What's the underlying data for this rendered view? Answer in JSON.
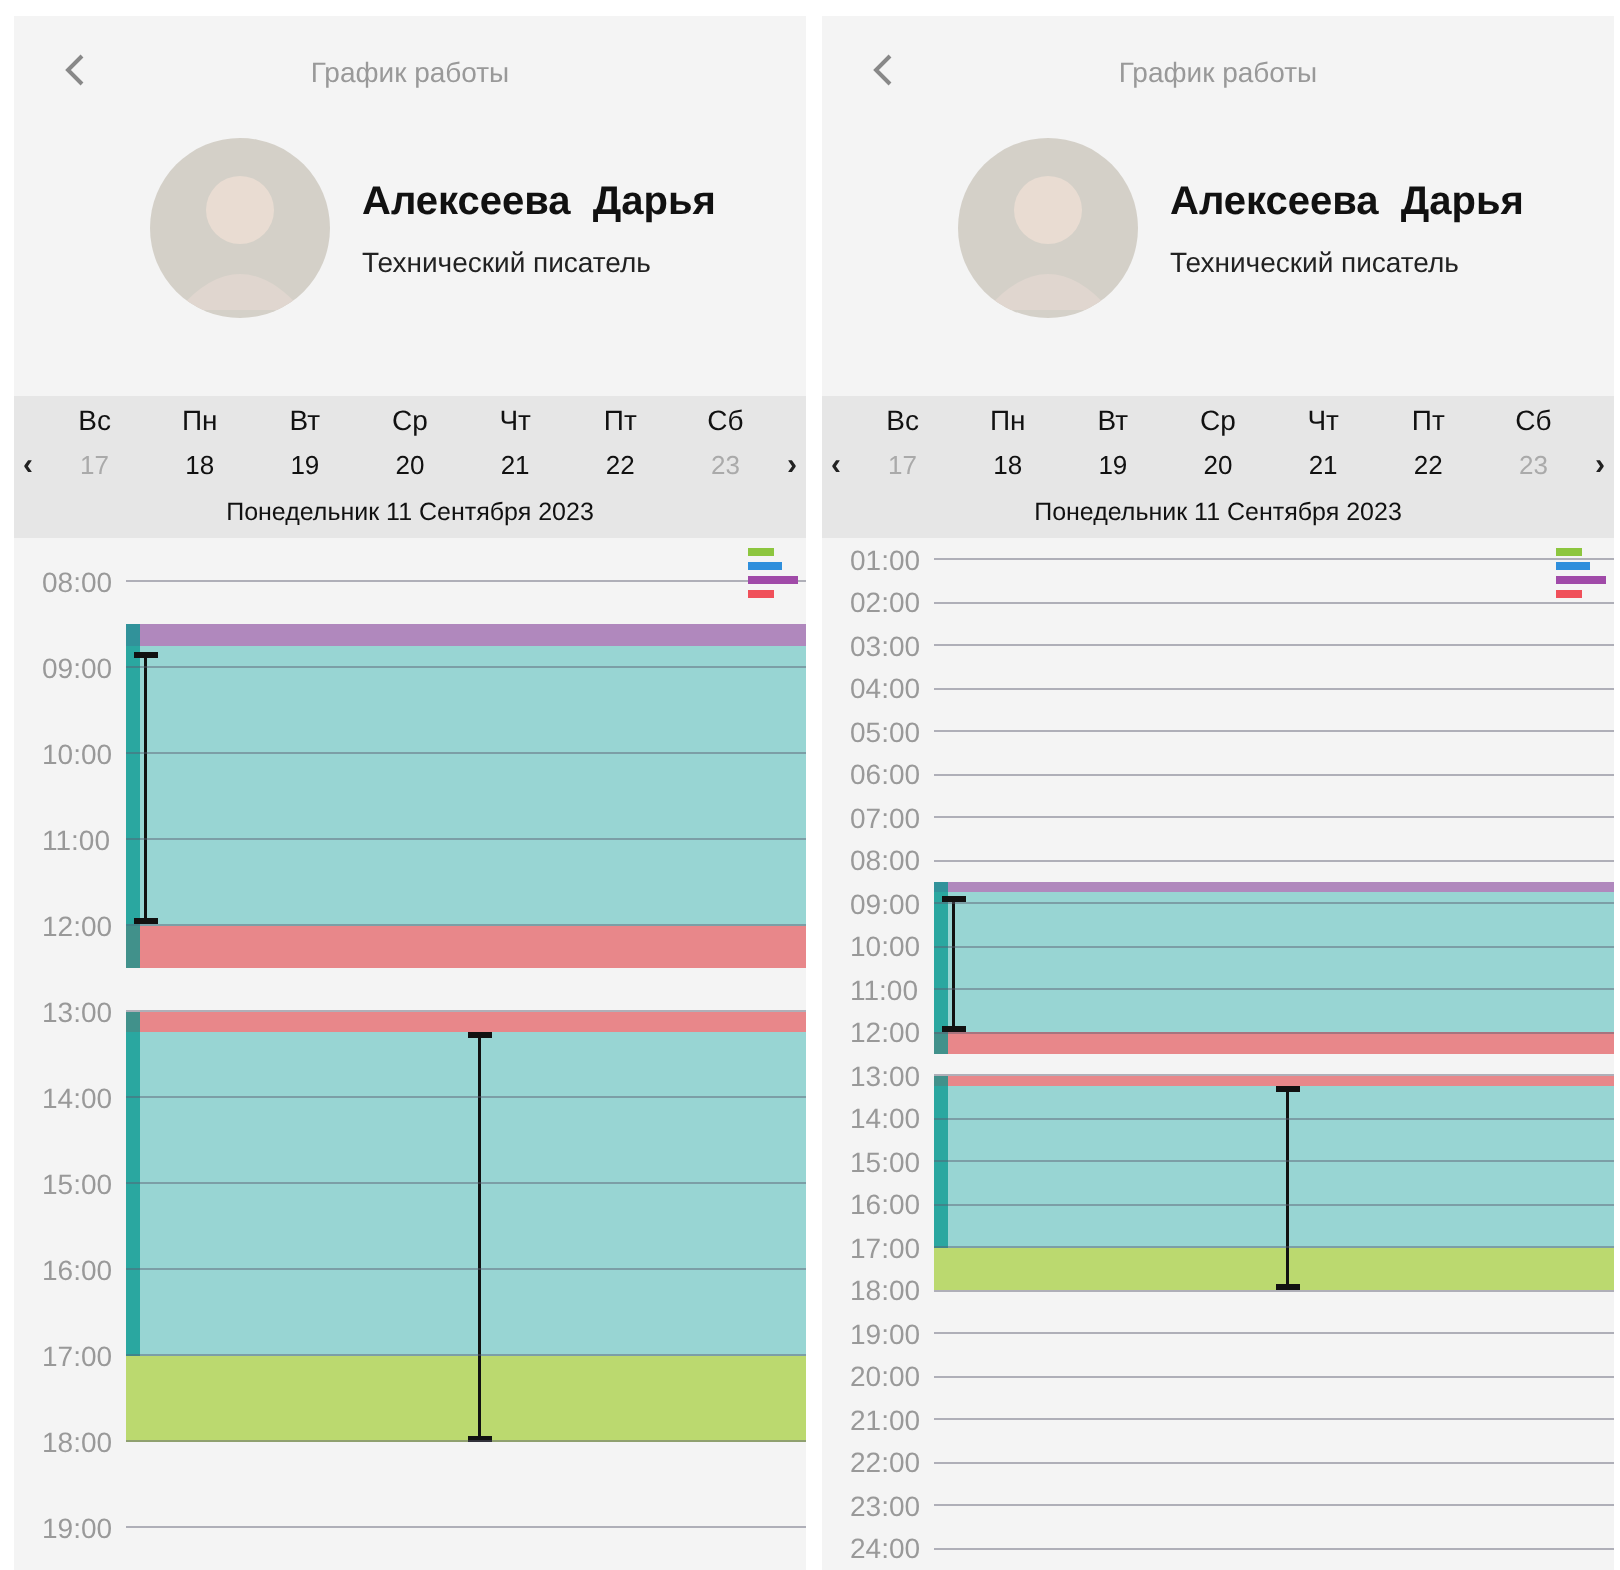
{
  "screens": [
    {
      "title": "График работы",
      "profile": {
        "name": "Алексеева  Дарья",
        "position": "Технический писатель"
      },
      "week": {
        "prev": "‹",
        "next": "›",
        "days": [
          {
            "weekday": "Вс",
            "date": "17",
            "disabled": true
          },
          {
            "weekday": "Пн",
            "date": "18",
            "disabled": false
          },
          {
            "weekday": "Вт",
            "date": "19",
            "disabled": false
          },
          {
            "weekday": "Ср",
            "date": "20",
            "disabled": false
          },
          {
            "weekday": "Чт",
            "date": "21",
            "disabled": false
          },
          {
            "weekday": "Пт",
            "date": "22",
            "disabled": false
          },
          {
            "weekday": "Сб",
            "date": "23",
            "disabled": true
          }
        ]
      },
      "current_date": "Понедельник 11 Сентября 2023",
      "timeline": {
        "hours": [
          "08:00",
          "09:00",
          "10:00",
          "11:00",
          "12:00",
          "13:00",
          "14:00",
          "15:00",
          "16:00",
          "17:00",
          "18:00",
          "19:00"
        ]
      }
    },
    {
      "title": "График работы",
      "profile": {
        "name": "Алексеева  Дарья",
        "position": "Технический писатель"
      },
      "week": {
        "prev": "‹",
        "next": "›",
        "days": [
          {
            "weekday": "Вс",
            "date": "17",
            "disabled": true
          },
          {
            "weekday": "Пн",
            "date": "18",
            "disabled": false
          },
          {
            "weekday": "Вт",
            "date": "19",
            "disabled": false
          },
          {
            "weekday": "Ср",
            "date": "20",
            "disabled": false
          },
          {
            "weekday": "Чт",
            "date": "21",
            "disabled": false
          },
          {
            "weekday": "Пт",
            "date": "22",
            "disabled": false
          },
          {
            "weekday": "Сб",
            "date": "23",
            "disabled": true
          }
        ]
      },
      "current_date": "Понедельник 11 Сентября 2023",
      "timeline": {
        "hours": [
          "01:00",
          "02:00",
          "03:00",
          "04:00",
          "05:00",
          "06:00",
          "07:00",
          "08:00",
          "09:00",
          "10:00",
          "11:00",
          "12:00",
          "13:00",
          "14:00",
          "15:00",
          "16:00",
          "17:00",
          "18:00",
          "19:00",
          "20:00",
          "21:00",
          "22:00",
          "23:00",
          "24:00"
        ]
      }
    }
  ]
}
